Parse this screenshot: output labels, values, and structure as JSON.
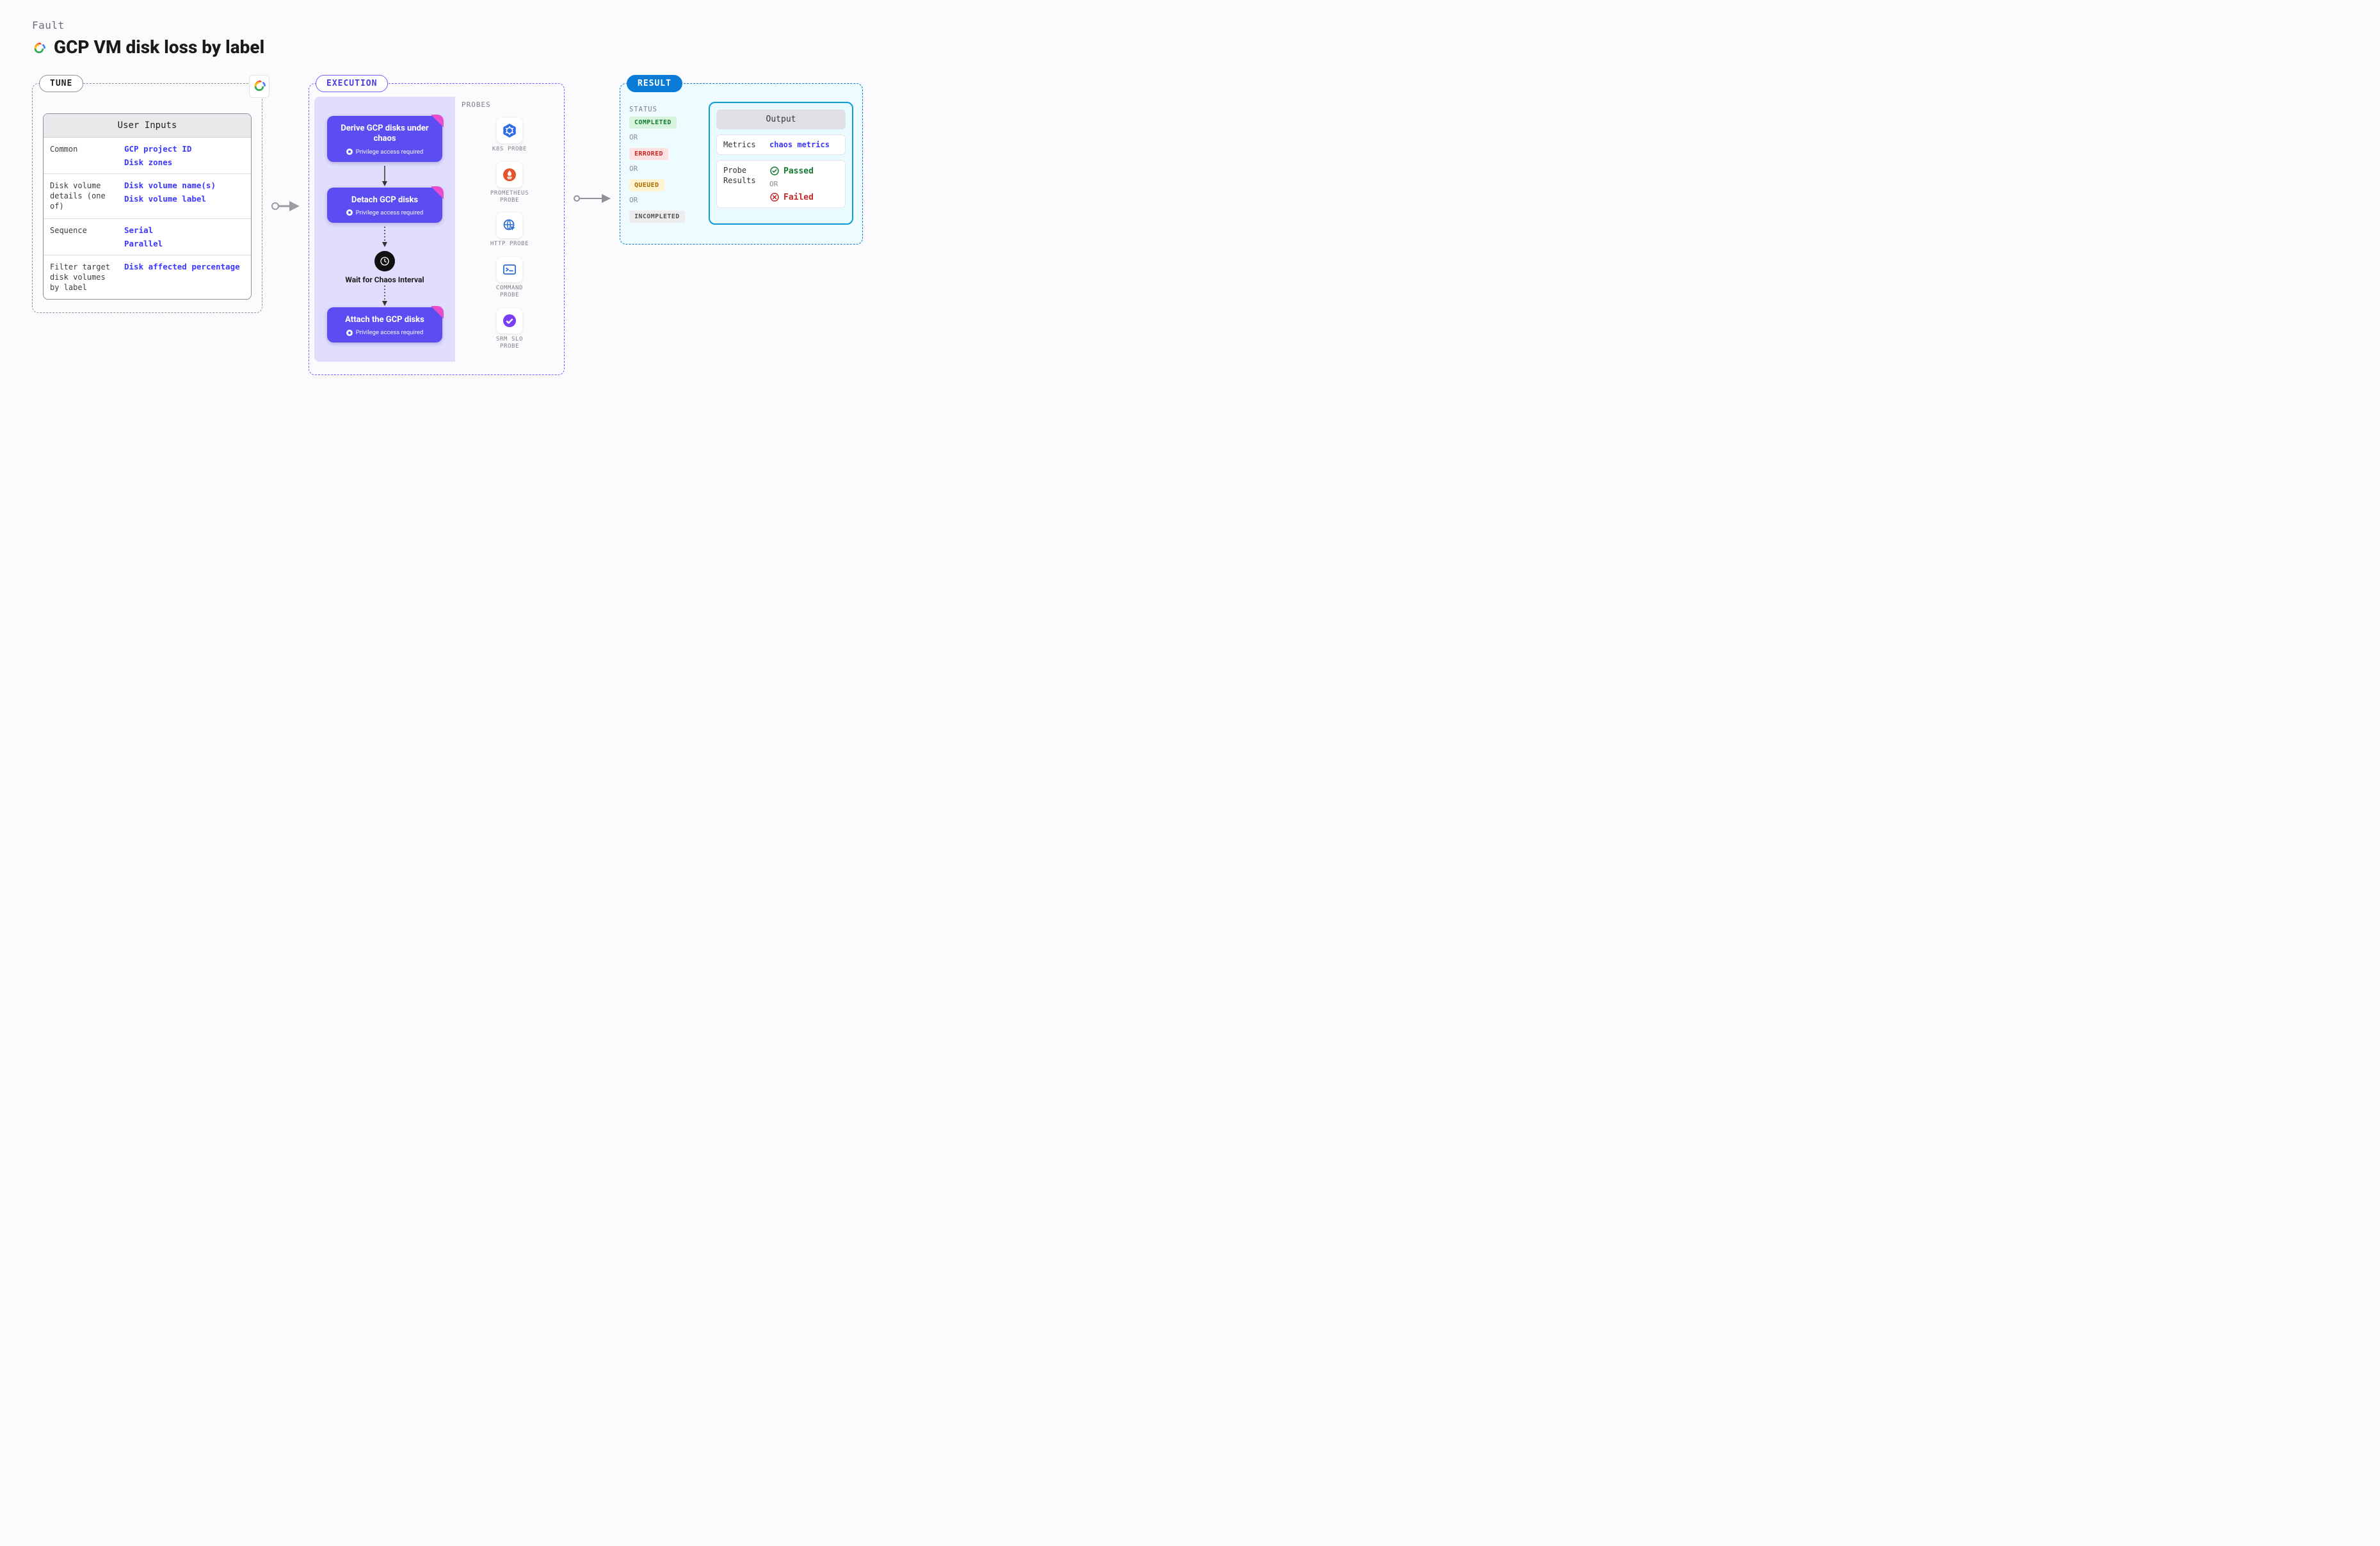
{
  "header": {
    "breadcrumb": "Fault",
    "title": "GCP VM disk loss by label"
  },
  "tune": {
    "pill": "TUNE",
    "card_title": "User Inputs",
    "rows": [
      {
        "label": "Common",
        "values": [
          "GCP project ID",
          "Disk zones"
        ]
      },
      {
        "label": "Disk volume details (one of)",
        "values": [
          "Disk volume name(s)",
          "Disk volume label"
        ]
      },
      {
        "label": "Sequence",
        "values": [
          "Serial",
          "Parallel"
        ]
      },
      {
        "label": "Filter target disk volumes by label",
        "values": [
          "Disk affected percentage"
        ]
      }
    ]
  },
  "execution": {
    "pill": "EXECUTION",
    "steps": [
      {
        "title": "Derive GCP disks under chaos",
        "sub": "Privilege access required"
      },
      {
        "title": "Detach GCP disks",
        "sub": "Privilege access required"
      }
    ],
    "wait_label": "Wait for Chaos Interval",
    "final_step": {
      "title": "Attach the GCP disks",
      "sub": "Privilege access required"
    },
    "probes_title": "PROBES",
    "probes": [
      {
        "name": "K8S PROBE",
        "icon": "k8s"
      },
      {
        "name": "PROMETHEUS PROBE",
        "icon": "prom"
      },
      {
        "name": "HTTP PROBE",
        "icon": "http"
      },
      {
        "name": "COMMAND PROBE",
        "icon": "cmd"
      },
      {
        "name": "SRM SLO PROBE",
        "icon": "slo"
      }
    ]
  },
  "result": {
    "pill": "RESULT",
    "status_title": "STATUS",
    "or": "OR",
    "statuses": [
      {
        "label": "COMPLETED",
        "cls": "b-completed"
      },
      {
        "label": "ERRORED",
        "cls": "b-errored"
      },
      {
        "label": "QUEUED",
        "cls": "b-queued"
      },
      {
        "label": "INCOMPLETED",
        "cls": "b-incompleted"
      }
    ],
    "output_title": "Output",
    "metrics_label": "Metrics",
    "metrics_value": "chaos metrics",
    "probe_results_label": "Probe Results",
    "passed": "Passed",
    "failed": "Failed"
  }
}
